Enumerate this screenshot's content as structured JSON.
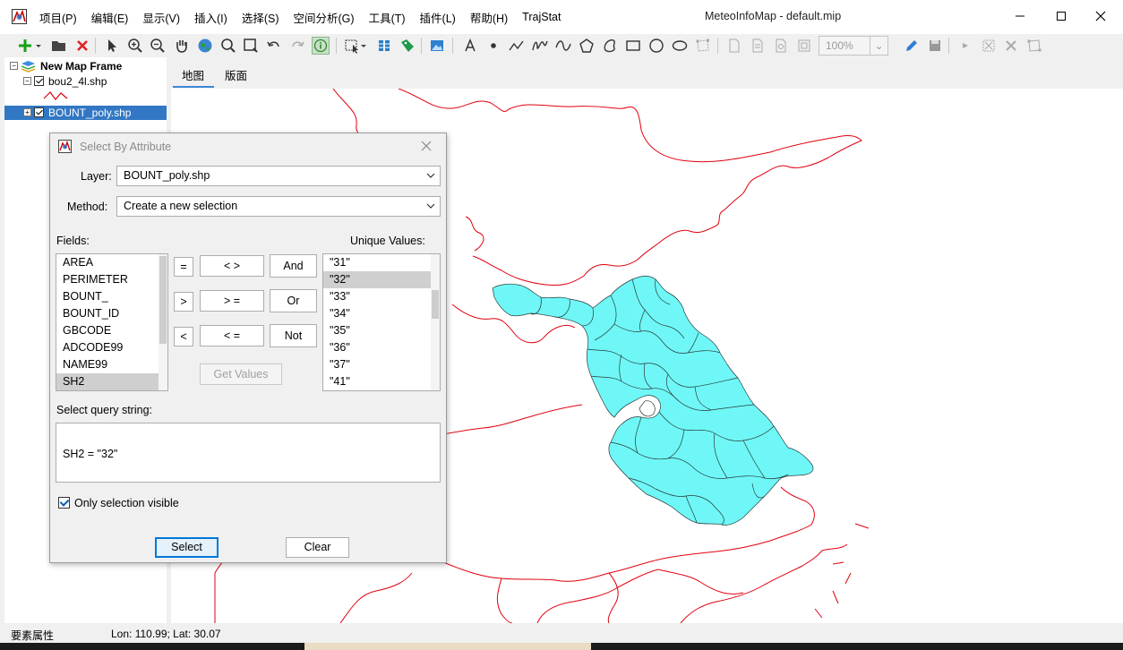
{
  "app": {
    "window_title": "MeteoInfoMap - default.mip",
    "menu": [
      "项目(P)",
      "编辑(E)",
      "显示(V)",
      "插入(I)",
      "选择(S)",
      "空间分析(G)",
      "工具(T)",
      "插件(L)",
      "帮助(H)",
      "TrajStat"
    ]
  },
  "toolbar": {
    "zoom_value": "100%"
  },
  "legend": {
    "frame_name": "New Map Frame",
    "layers": [
      {
        "name": "bou2_4l.shp",
        "checked": true
      },
      {
        "name": "BOUNT_poly.shp",
        "checked": true,
        "selected": true
      }
    ]
  },
  "tabs": [
    {
      "label": "地图",
      "active": true
    },
    {
      "label": "版面",
      "active": false
    }
  ],
  "status": {
    "attr_label": "要素属性",
    "coords": "Lon: 110.99; Lat: 30.07"
  },
  "colors": {
    "boundary": "#e0000e",
    "selected_fill": "#6ff7f7",
    "accent": "#0078d7"
  },
  "dialog": {
    "title": "Select By Attribute",
    "layer_label": "Layer:",
    "layer_value": "BOUNT_poly.shp",
    "method_label": "Method:",
    "method_value": "Create a new selection",
    "fields_label": "Fields:",
    "fields": [
      "AREA",
      "PERIMETER",
      "BOUNT_",
      "BOUNT_ID",
      "GBCODE",
      "ADCODE99",
      "NAME99",
      "SH2"
    ],
    "selected_field": "SH2",
    "unique_label": "Unique Values:",
    "unique_values": [
      "\"31\"",
      "\"32\"",
      "\"33\"",
      "\"34\"",
      "\"35\"",
      "\"36\"",
      "\"37\"",
      "\"41\""
    ],
    "selected_value": "\"32\"",
    "operators": {
      "eq": "=",
      "ne": "< >",
      "and": "And",
      "gt": ">",
      "ge": "> =",
      "or": "Or",
      "lt": "<",
      "le": "< =",
      "not": "Not"
    },
    "get_values_label": "Get Values",
    "query_label": "Select query string:",
    "query": "SH2 = \"32\"",
    "only_visible_label": "Only selection visible",
    "only_visible_checked": true,
    "select_label": "Select",
    "clear_label": "Clear"
  }
}
